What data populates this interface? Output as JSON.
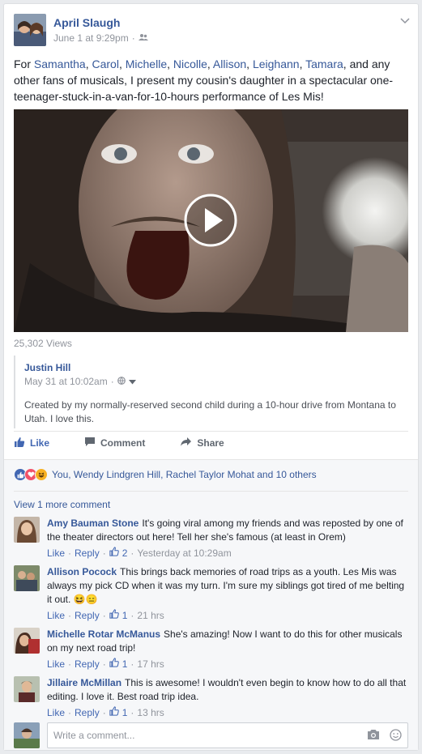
{
  "post": {
    "author": "April Slaugh",
    "date": "June 1 at 9:29pm",
    "audience_icon": "friends-icon",
    "text_segments": {
      "s0": "For ",
      "n1": "Samantha",
      "s1": ", ",
      "n2": "Carol",
      "s2": ", ",
      "n3": "Michelle",
      "s3": ", ",
      "n4": "Nicolle",
      "s4": ", ",
      "n5": "Allison",
      "s5": ", ",
      "n6": "Leighann",
      "s6": ", ",
      "n7": "Tamara",
      "s7": ", and any other fans of musicals, I present my cousin's daughter in a spectacular one-teenager-stuck-in-a-van-for-10-hours performance of Les Mis!"
    },
    "views": "25,302 Views"
  },
  "shared": {
    "author": "Justin Hill",
    "date": "May 31 at 10:02am",
    "text": "Created by my normally-reserved second child during a 10-hour drive from Montana to Utah. I love this."
  },
  "actions": {
    "like": "Like",
    "comment": "Comment",
    "share": "Share"
  },
  "reactions": {
    "types": [
      "like",
      "love",
      "haha"
    ],
    "summary": "You, Wendy Lindgren Hill, Rachel Taylor Mohat and 10 others"
  },
  "view_more": "View 1 more comment",
  "comments": [
    {
      "author": "Amy Bauman Stone",
      "text": "It's going viral among my friends and was reposted by one of the theater directors out here! Tell her she's famous (at least in Orem)",
      "like": "Like",
      "reply": "Reply",
      "likes": "2",
      "time": "Yesterday at 10:29am"
    },
    {
      "author": "Allison Pocock",
      "text": "This brings back memories of road trips as a youth. Les Mis was always my pick CD when it was my turn. I'm sure my siblings got tired of me belting it out.",
      "emoji": "😆😑",
      "like": "Like",
      "reply": "Reply",
      "likes": "1",
      "time": "21 hrs"
    },
    {
      "author": "Michelle Rotar McManus",
      "text": "She's amazing! Now I want to do this for other musicals on my next road trip!",
      "like": "Like",
      "reply": "Reply",
      "likes": "1",
      "time": "17 hrs"
    },
    {
      "author": "Jillaire McMillan",
      "text": "This is awesome! I wouldn't even begin to know how to do all that editing. I love it. Best road trip idea.",
      "like": "Like",
      "reply": "Reply",
      "likes": "1",
      "time": "13 hrs"
    }
  ],
  "composer": {
    "placeholder": "Write a comment..."
  },
  "colors": {
    "link": "#365899",
    "like_blue": "#4267b2",
    "meta_gray": "#90949c",
    "love_red": "#f25268",
    "haha_yellow": "#f7b125"
  }
}
